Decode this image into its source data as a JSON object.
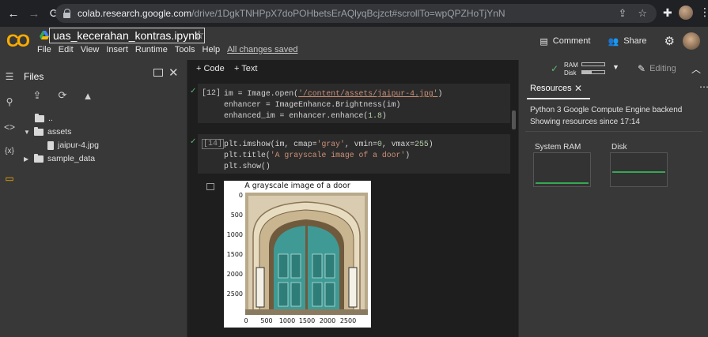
{
  "browser": {
    "url_host": "colab.research.google.com",
    "url_path": "/drive/1DgkTNHPpX7doPOHbetsErAQlyqBcjzct#scrollTo=wpQPZHoTjYnN"
  },
  "header": {
    "logo_text": "CO",
    "notebook_title": "uas_kecerahan_kontras.ipynb",
    "menu": [
      "File",
      "Edit",
      "View",
      "Insert",
      "Runtime",
      "Tools",
      "Help"
    ],
    "save_status": "All changes saved",
    "comment_label": "Comment",
    "share_label": "Share"
  },
  "toolbar": {
    "add_code": "+ Code",
    "add_text": "+ Text",
    "ram_label": "RAM",
    "disk_label": "Disk",
    "editing_label": "Editing"
  },
  "files": {
    "title": "Files",
    "tree": [
      {
        "name": "..",
        "type": "folder-up"
      },
      {
        "name": "assets",
        "type": "folder",
        "expanded": true
      },
      {
        "name": "jaipur-4.jpg",
        "type": "file"
      },
      {
        "name": "sample_data",
        "type": "folder",
        "expanded": false
      }
    ]
  },
  "rail": {
    "variables_label": "{x}"
  },
  "cells": [
    {
      "exec_count": "[12]",
      "lines": [
        "im = Image.open('/content/assets/jaipur-4.jpg')",
        "enhancer = ImageEnhance.Brightness(im)",
        "enhanced_im = enhancer.enhance(1.8)"
      ]
    },
    {
      "exec_count": "[14]",
      "lines": [
        "plt.imshow(im, cmap='gray', vmin=0, vmax=255)",
        "plt.title('A grayscale image of a door')",
        "plt.show()"
      ]
    }
  ],
  "plot": {
    "title": "A grayscale image of a door",
    "yticks": [
      "0",
      "500",
      "1000",
      "1500",
      "2000",
      "2500"
    ],
    "xticks": [
      "0",
      "500",
      "1000",
      "1500",
      "2000",
      "2500"
    ]
  },
  "resources": {
    "tab_label": "Resources",
    "backend_line": "Python 3 Google Compute Engine backend",
    "since_line": "Showing resources since 17:14",
    "cards": [
      {
        "label": "System RAM"
      },
      {
        "label": "Disk"
      }
    ]
  }
}
